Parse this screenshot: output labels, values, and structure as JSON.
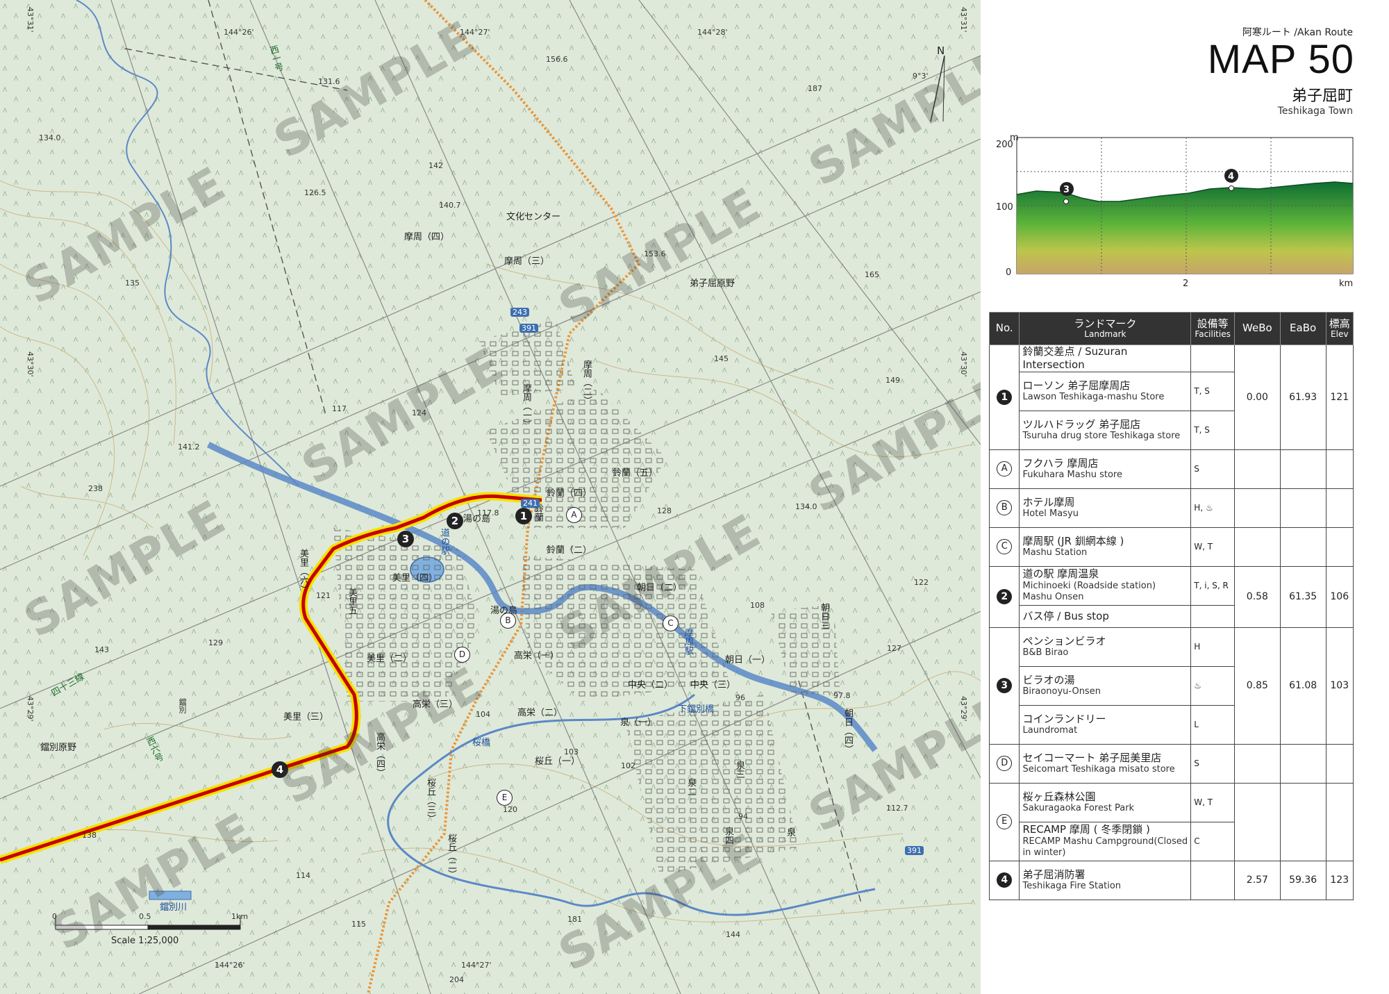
{
  "map": {
    "district_labels": [
      "摩周（四）",
      "摩周（三）",
      "文化センター",
      "弟子屈原野",
      "摩周（一）",
      "摩周（二）",
      "鈴蘭（四）",
      "鈴蘭（五）",
      "鈴蘭（二）",
      "湯の島",
      "湯の島",
      "美里（四）",
      "美里（六）",
      "美里五",
      "美里（二）",
      "美里（三）",
      "高栄（一）",
      "高栄（二）",
      "高栄（三）",
      "高栄（四）",
      "朝日（二）",
      "朝日（一）",
      "朝日三",
      "朝日（四）",
      "中央（二）",
      "中央（三）",
      "泉（一）",
      "桜丘（一）",
      "桜丘（三）",
      "桜丘（二）",
      "泉三",
      "泉二",
      "泉四",
      "泉",
      "鐺別原野",
      "四十三線",
      "西六号",
      "西一号",
      "鐺別",
      "鐺別川",
      "下鐺別橋",
      "桜橋",
      "道の駅",
      "鈴蘭",
      "摩周駅"
    ],
    "coordinate_labels": {
      "lon_top": [
        "144°26'",
        "144°27'",
        "144°28'"
      ],
      "lon_bottom": [
        "144°26'",
        "144°27'",
        "144°28'"
      ],
      "lat_left": [
        "43°31'",
        "43°30'",
        "43°29'"
      ],
      "lat_right": [
        "43°31'",
        "43°30'",
        "43°29'"
      ]
    },
    "elevation_points": [
      "131.6",
      "134.0",
      "126.5",
      "140.7",
      "142",
      "156.6",
      "153.6",
      "141.2",
      "238",
      "117.8",
      "117",
      "124",
      "135",
      "143",
      "129",
      "121",
      "187",
      "165",
      "145",
      "149",
      "134.0",
      "128",
      "122",
      "108",
      "97.8",
      "127",
      "114",
      "115",
      "104",
      "120",
      "103",
      "102",
      "96",
      "94",
      "112.7",
      "181",
      "144",
      "204",
      "138"
    ],
    "road_numbers": [
      "243",
      "391",
      "241",
      "391"
    ],
    "north_label": "N",
    "declination": "9°3'",
    "scale_label": "Scale 1:25,000",
    "scale_ticks": [
      "0",
      "0.5",
      "1km"
    ],
    "route_markers": [
      "1",
      "2",
      "3",
      "4"
    ],
    "landmark_markers": [
      "A",
      "B",
      "C",
      "D",
      "E"
    ],
    "watermark_text": "SAMPLE",
    "route_color": "#d60000",
    "route_halo_color": "#f4e200",
    "railway_color": "#e8963a",
    "river_color": "#5b88c7"
  },
  "header": {
    "route_sub": "阿寒ルート /Akan Route",
    "map_title": "MAP 50",
    "town_jp": "弟子屈町",
    "town_en": "Teshikaga Town"
  },
  "profile": {
    "unit_y": "m",
    "y_ticks": [
      "200",
      "100",
      "0"
    ],
    "x_ticks": [
      "2"
    ],
    "unit_x": "km",
    "markers": [
      "3",
      "4"
    ]
  },
  "table": {
    "headers": {
      "no": "No.",
      "landmark_jp": "ランドマーク",
      "landmark_en": "Landmark",
      "facilities_jp": "設備等",
      "facilities_en": "Facilities",
      "webo": "WeBo",
      "eabo": "EaBo",
      "elev_jp": "標高",
      "elev_en": "Elev"
    },
    "groups": [
      {
        "no": "1",
        "filled": true,
        "webo": "0.00",
        "eabo": "61.93",
        "elev": "121",
        "rows": [
          {
            "jp": "鈴蘭交差点 / Suzuran Intersection",
            "en": "",
            "fac": ""
          },
          {
            "jp": "ローソン 弟子屈摩周店",
            "en": "Lawson Teshikaga-mashu Store",
            "fac": "T, S"
          },
          {
            "jp": "ツルハドラッグ 弟子屈店",
            "en": "Tsuruha drug store Teshikaga store",
            "fac": "T, S"
          }
        ]
      },
      {
        "no": "A",
        "filled": false,
        "webo": "",
        "eabo": "",
        "elev": "",
        "rows": [
          {
            "jp": "フクハラ 摩周店",
            "en": "Fukuhara Mashu store",
            "fac": "S"
          }
        ]
      },
      {
        "no": "B",
        "filled": false,
        "webo": "",
        "eabo": "",
        "elev": "",
        "rows": [
          {
            "jp": "ホテル摩周",
            "en": "Hotel Masyu",
            "fac": "H, ♨"
          }
        ]
      },
      {
        "no": "C",
        "filled": false,
        "webo": "",
        "eabo": "",
        "elev": "",
        "rows": [
          {
            "jp": "摩周駅 (JR 釧網本線 )",
            "en": "Mashu Station",
            "fac": "W, T"
          }
        ]
      },
      {
        "no": "2",
        "filled": true,
        "webo": "0.58",
        "eabo": "61.35",
        "elev": "106",
        "rows": [
          {
            "jp": "道の駅 摩周温泉",
            "en": "Michinoeki (Roadside station) Mashu Onsen",
            "fac": "T, i, S, R"
          },
          {
            "jp": "バス停 / Bus stop",
            "en": "",
            "fac": ""
          }
        ]
      },
      {
        "no": "3",
        "filled": true,
        "webo": "0.85",
        "eabo": "61.08",
        "elev": "103",
        "rows": [
          {
            "jp": "ペンションビラオ",
            "en": "B&B Birao",
            "fac": "H"
          },
          {
            "jp": "ビラオの湯",
            "en": "Biraonoyu-Onsen",
            "fac": "♨"
          },
          {
            "jp": "コインランドリー",
            "en": "Laundromat",
            "fac": "L"
          }
        ]
      },
      {
        "no": "D",
        "filled": false,
        "webo": "",
        "eabo": "",
        "elev": "",
        "rows": [
          {
            "jp": "セイコーマート 弟子屈美里店",
            "en": "Seicomart Teshikaga misato store",
            "fac": "S"
          }
        ]
      },
      {
        "no": "E",
        "filled": false,
        "webo": "",
        "eabo": "",
        "elev": "",
        "rows": [
          {
            "jp": "桜ヶ丘森林公園",
            "en": "Sakuragaoka Forest Park",
            "fac": "W, T"
          },
          {
            "jp": "RECAMP 摩周 ( 冬季閉鎖 )",
            "en": "RECAMP Mashu Campground(Closed in winter)",
            "fac": "C"
          }
        ]
      },
      {
        "no": "4",
        "filled": true,
        "webo": "2.57",
        "eabo": "59.36",
        "elev": "123",
        "rows": [
          {
            "jp": "弟子屈消防署",
            "en": "Teshikaga Fire Station",
            "fac": ""
          }
        ]
      }
    ]
  }
}
